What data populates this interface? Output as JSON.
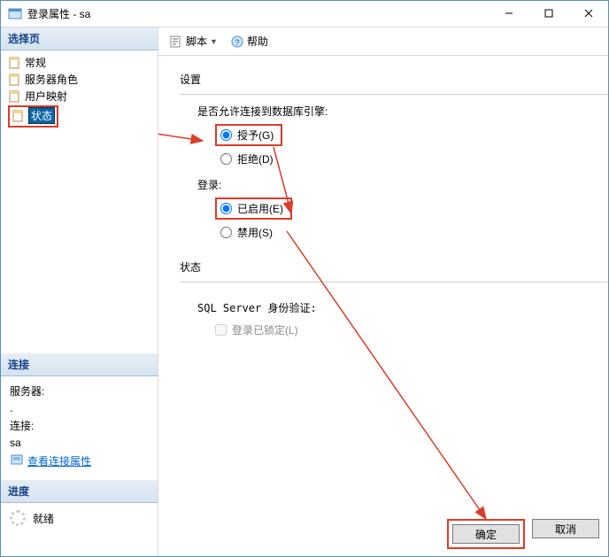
{
  "window": {
    "title": "登录属性 - sa"
  },
  "leftpane": {
    "select_header": "选择页",
    "nav": {
      "general": "常规",
      "server_roles": "服务器角色",
      "user_mapping": "用户映射",
      "status": "状态"
    },
    "connection_header": "连接",
    "connection": {
      "server_label": "服务器:",
      "server_value": ".",
      "conn_label": "连接:",
      "conn_value": "sa",
      "view_props": "查看连接属性"
    },
    "progress_header": "进度",
    "progress": {
      "ready": "就绪"
    }
  },
  "toolbar": {
    "script": "脚本",
    "help": "帮助"
  },
  "content": {
    "settings": "设置",
    "permit_conn": "是否允许连接到数据库引擎:",
    "grant": "授予(G)",
    "deny": "拒绝(D)",
    "login": "登录:",
    "enabled": "已启用(E)",
    "disabled": "禁用(S)",
    "status": "状态",
    "sql_auth": "SQL Server 身份验证:",
    "locked": "登录已锁定(L)"
  },
  "buttons": {
    "ok": "确定",
    "cancel": "取消"
  },
  "colors": {
    "highlight": "#dc3c28",
    "link": "#0066cc"
  }
}
